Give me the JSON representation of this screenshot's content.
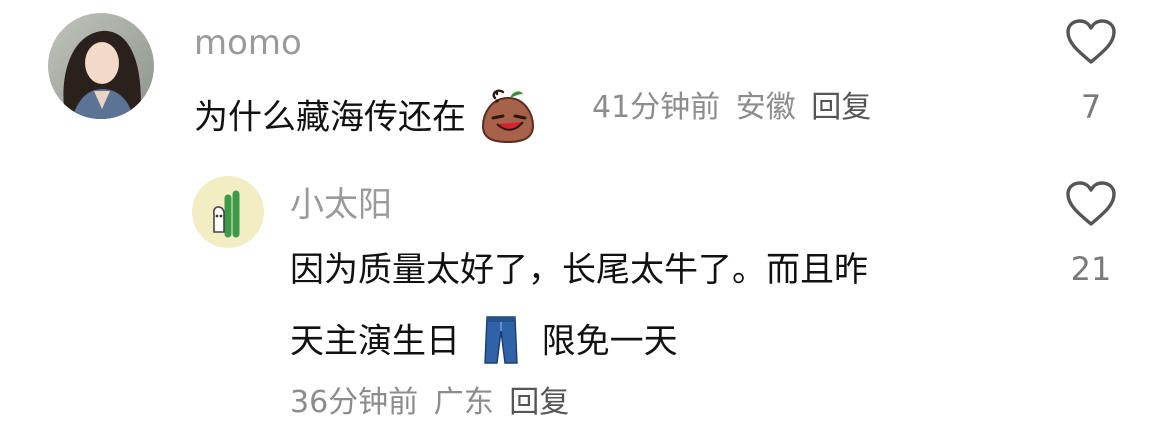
{
  "comments": [
    {
      "username": "momo",
      "text": "为什么藏海传还在",
      "emoji": "smirking-potato-emoji",
      "time": "41分钟前",
      "location": "安徽",
      "reply_label": "回复",
      "likes": "7"
    }
  ],
  "replies": [
    {
      "username": "小太阳",
      "text_line1": "因为质量太好了，长尾太牛了。而且昨",
      "text_line2_a": "天主演生日",
      "emoji": "jeans-emoji",
      "text_line2_b": "限免一天",
      "time": "36分钟前",
      "location": "广东",
      "reply_label": "回复",
      "likes": "21"
    }
  ],
  "colors": {
    "username": "#9a9a9a",
    "text": "#111111",
    "meta": "#8c8c8c",
    "heart_stroke": "#555555",
    "reply_avatar_bg": "#f3edc4"
  }
}
